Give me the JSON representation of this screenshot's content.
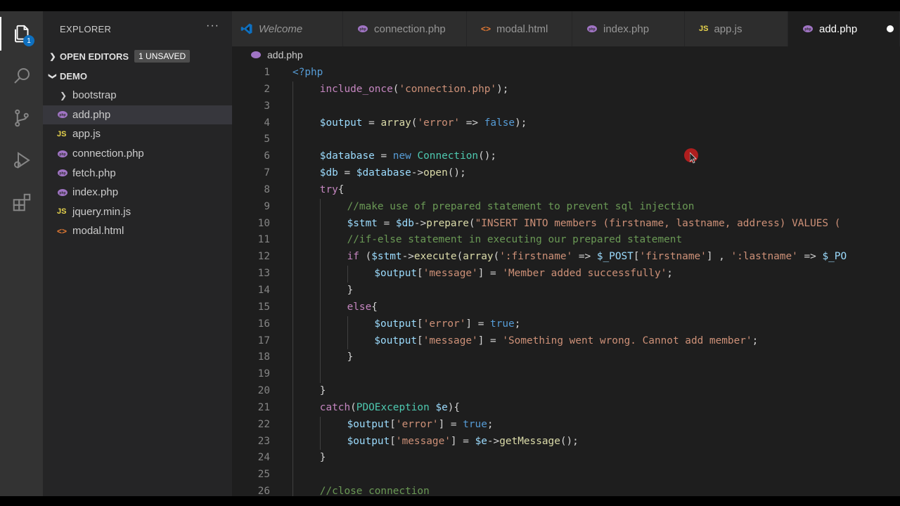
{
  "activity_bar": {
    "explorer_badge": "1"
  },
  "sidebar": {
    "title": "EXPLORER",
    "more": "···",
    "open_editors": {
      "label": "OPEN EDITORS",
      "badge": "1 UNSAVED"
    },
    "folder": "DEMO",
    "items": [
      {
        "label": "bootstrap",
        "type": "folder"
      },
      {
        "label": "add.php",
        "type": "php"
      },
      {
        "label": "app.js",
        "type": "js"
      },
      {
        "label": "connection.php",
        "type": "php"
      },
      {
        "label": "fetch.php",
        "type": "php"
      },
      {
        "label": "index.php",
        "type": "php"
      },
      {
        "label": "jquery.min.js",
        "type": "js"
      },
      {
        "label": "modal.html",
        "type": "html"
      }
    ]
  },
  "tabs": [
    {
      "label": "Welcome",
      "type": "vscode"
    },
    {
      "label": "connection.php",
      "type": "php"
    },
    {
      "label": "modal.html",
      "type": "html"
    },
    {
      "label": "index.php",
      "type": "php"
    },
    {
      "label": "app.js",
      "type": "js"
    },
    {
      "label": "add.php",
      "type": "php",
      "active": true
    }
  ],
  "breadcrumb": "add.php",
  "code_lines": [
    {
      "n": "1",
      "indent": 0,
      "text": "<?php"
    },
    {
      "n": "2",
      "indent": 1,
      "text": "include_once('connection.php');"
    },
    {
      "n": "3",
      "indent": 1,
      "text": ""
    },
    {
      "n": "4",
      "indent": 1,
      "text": "$output = array('error' => false);"
    },
    {
      "n": "5",
      "indent": 1,
      "text": ""
    },
    {
      "n": "6",
      "indent": 1,
      "text": "$database = new Connection();"
    },
    {
      "n": "7",
      "indent": 1,
      "text": "$db = $database->open();"
    },
    {
      "n": "8",
      "indent": 1,
      "text": "try{"
    },
    {
      "n": "9",
      "indent": 2,
      "text": "//make use of prepared statement to prevent sql injection"
    },
    {
      "n": "10",
      "indent": 2,
      "text": "$stmt = $db->prepare(\"INSERT INTO members (firstname, lastname, address) VALUES ("
    },
    {
      "n": "11",
      "indent": 2,
      "text": "//if-else statement in executing our prepared statement"
    },
    {
      "n": "12",
      "indent": 2,
      "text": "if ($stmt->execute(array(':firstname' => $_POST['firstname'] , ':lastname' => $_PO"
    },
    {
      "n": "13",
      "indent": 3,
      "text": "$output['message'] = 'Member added successfully';"
    },
    {
      "n": "14",
      "indent": 2,
      "text": "}"
    },
    {
      "n": "15",
      "indent": 2,
      "text": "else{"
    },
    {
      "n": "16",
      "indent": 3,
      "text": "$output['error'] = true;"
    },
    {
      "n": "17",
      "indent": 3,
      "text": "$output['message'] = 'Something went wrong. Cannot add member';"
    },
    {
      "n": "18",
      "indent": 2,
      "text": "}"
    },
    {
      "n": "19",
      "indent": 2,
      "text": ""
    },
    {
      "n": "20",
      "indent": 1,
      "text": "}"
    },
    {
      "n": "21",
      "indent": 1,
      "text": "catch(PDOException $e){"
    },
    {
      "n": "22",
      "indent": 2,
      "text": "$output['error'] = true;"
    },
    {
      "n": "23",
      "indent": 2,
      "text": "$output['message'] = $e->getMessage();"
    },
    {
      "n": "24",
      "indent": 1,
      "text": "}"
    },
    {
      "n": "25",
      "indent": 1,
      "text": ""
    },
    {
      "n": "26",
      "indent": 1,
      "text": "//close connection"
    }
  ],
  "colors": {
    "php_icon": "#a074c4",
    "js_icon": "#e8d44d",
    "html_icon": "#e37933",
    "accent": "#0e70c0"
  }
}
